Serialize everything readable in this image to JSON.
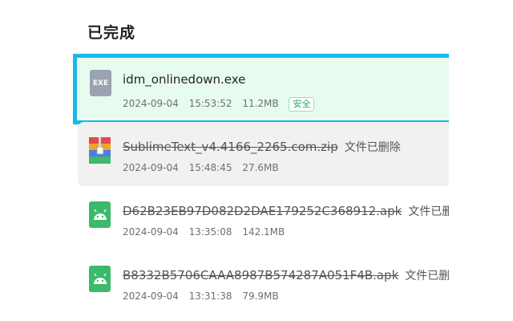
{
  "section_title": "已完成",
  "downloads": [
    {
      "icon": "exe-file-icon",
      "icon_label": "EXE",
      "name": "idm_onlinedown.exe",
      "date": "2024-09-04",
      "time": "15:53:52",
      "size": "11.2MB",
      "badge": "安全",
      "status": ""
    },
    {
      "icon": "zip-archive-icon",
      "name": "SublimeText_v4.4166_2265.com.zip",
      "date": "2024-09-04",
      "time": "15:48:45",
      "size": "27.6MB",
      "status": "文件已删除"
    },
    {
      "icon": "android-apk-icon",
      "name": "D62B23EB97D082D2DAE179252C368912.apk",
      "date": "2024-09-04",
      "time": "13:35:08",
      "size": "142.1MB",
      "status": "文件已删"
    },
    {
      "icon": "android-apk-icon",
      "name": "B8332B5706CAAA8987B574287A051F4B.apk",
      "date": "2024-09-04",
      "time": "13:31:38",
      "size": "79.9MB",
      "status": "文件已删"
    }
  ],
  "colors": {
    "selected_border": "#19b8e8",
    "selected_bg": "#e8fbef",
    "hover_bg": "#f1f1f1",
    "apk_icon": "#3db96a",
    "safe_badge": "#28a36a"
  }
}
